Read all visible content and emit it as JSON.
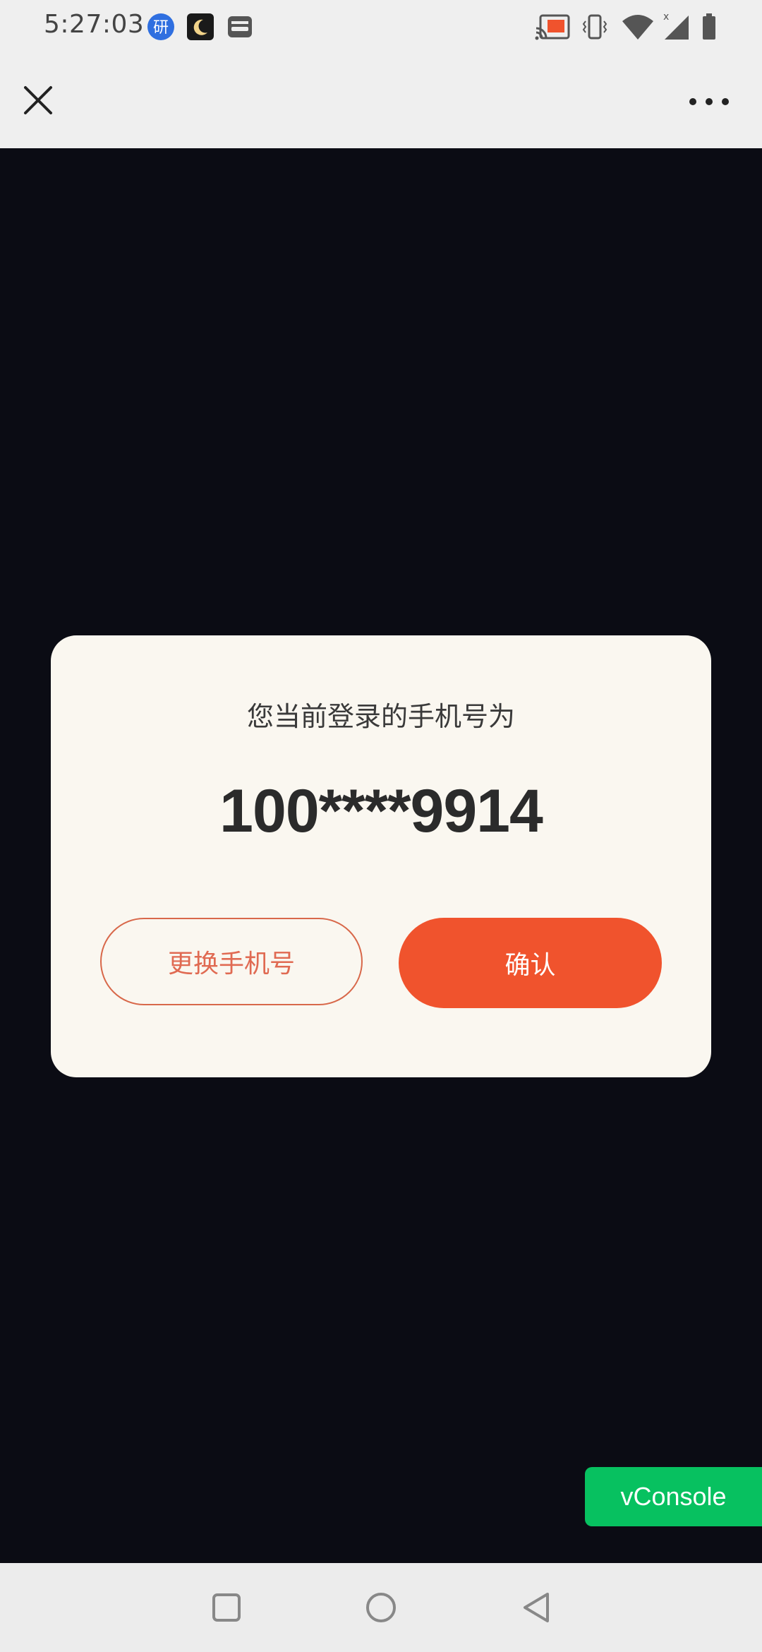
{
  "status_bar": {
    "time": "5:27:03",
    "left_icons": [
      "translate-app-icon",
      "moon-app-icon",
      "inbox-app-icon"
    ],
    "right_icons": [
      "cast-icon",
      "vibrate-icon",
      "wifi-icon",
      "signal-icon",
      "battery-icon"
    ]
  },
  "nav": {
    "close_icon": "close-icon",
    "more_icon": "more-icon"
  },
  "modal": {
    "title": "您当前登录的手机号为",
    "phone": "100****9914",
    "change_label": "更换手机号",
    "confirm_label": "确认"
  },
  "vconsole": {
    "label": "vConsole"
  },
  "system_nav": {
    "icons": [
      "recents-icon",
      "home-icon",
      "back-icon"
    ]
  },
  "colors": {
    "accent": "#f0532d",
    "accent_outline": "#d8684a",
    "page_background": "#0b0c14",
    "modal_background": "#faf7f0",
    "vconsole_green": "#07c160"
  }
}
